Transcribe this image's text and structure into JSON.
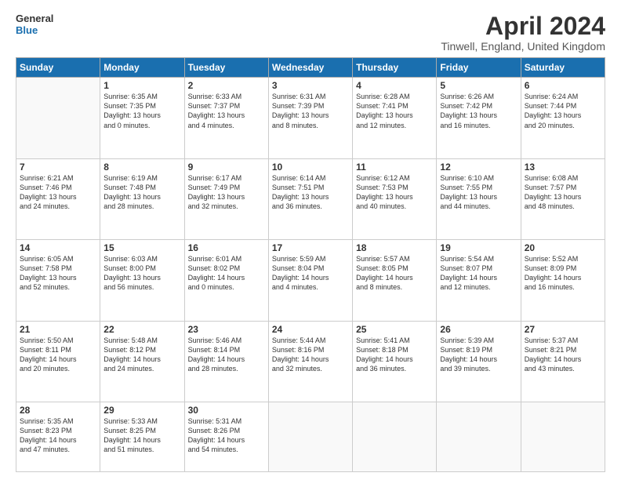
{
  "logo": {
    "line1": "General",
    "line2": "Blue"
  },
  "title": "April 2024",
  "subtitle": "Tinwell, England, United Kingdom",
  "days_of_week": [
    "Sunday",
    "Monday",
    "Tuesday",
    "Wednesday",
    "Thursday",
    "Friday",
    "Saturday"
  ],
  "weeks": [
    [
      {
        "day": "",
        "info": ""
      },
      {
        "day": "1",
        "info": "Sunrise: 6:35 AM\nSunset: 7:35 PM\nDaylight: 13 hours\nand 0 minutes."
      },
      {
        "day": "2",
        "info": "Sunrise: 6:33 AM\nSunset: 7:37 PM\nDaylight: 13 hours\nand 4 minutes."
      },
      {
        "day": "3",
        "info": "Sunrise: 6:31 AM\nSunset: 7:39 PM\nDaylight: 13 hours\nand 8 minutes."
      },
      {
        "day": "4",
        "info": "Sunrise: 6:28 AM\nSunset: 7:41 PM\nDaylight: 13 hours\nand 12 minutes."
      },
      {
        "day": "5",
        "info": "Sunrise: 6:26 AM\nSunset: 7:42 PM\nDaylight: 13 hours\nand 16 minutes."
      },
      {
        "day": "6",
        "info": "Sunrise: 6:24 AM\nSunset: 7:44 PM\nDaylight: 13 hours\nand 20 minutes."
      }
    ],
    [
      {
        "day": "7",
        "info": "Sunrise: 6:21 AM\nSunset: 7:46 PM\nDaylight: 13 hours\nand 24 minutes."
      },
      {
        "day": "8",
        "info": "Sunrise: 6:19 AM\nSunset: 7:48 PM\nDaylight: 13 hours\nand 28 minutes."
      },
      {
        "day": "9",
        "info": "Sunrise: 6:17 AM\nSunset: 7:49 PM\nDaylight: 13 hours\nand 32 minutes."
      },
      {
        "day": "10",
        "info": "Sunrise: 6:14 AM\nSunset: 7:51 PM\nDaylight: 13 hours\nand 36 minutes."
      },
      {
        "day": "11",
        "info": "Sunrise: 6:12 AM\nSunset: 7:53 PM\nDaylight: 13 hours\nand 40 minutes."
      },
      {
        "day": "12",
        "info": "Sunrise: 6:10 AM\nSunset: 7:55 PM\nDaylight: 13 hours\nand 44 minutes."
      },
      {
        "day": "13",
        "info": "Sunrise: 6:08 AM\nSunset: 7:57 PM\nDaylight: 13 hours\nand 48 minutes."
      }
    ],
    [
      {
        "day": "14",
        "info": "Sunrise: 6:05 AM\nSunset: 7:58 PM\nDaylight: 13 hours\nand 52 minutes."
      },
      {
        "day": "15",
        "info": "Sunrise: 6:03 AM\nSunset: 8:00 PM\nDaylight: 13 hours\nand 56 minutes."
      },
      {
        "day": "16",
        "info": "Sunrise: 6:01 AM\nSunset: 8:02 PM\nDaylight: 14 hours\nand 0 minutes."
      },
      {
        "day": "17",
        "info": "Sunrise: 5:59 AM\nSunset: 8:04 PM\nDaylight: 14 hours\nand 4 minutes."
      },
      {
        "day": "18",
        "info": "Sunrise: 5:57 AM\nSunset: 8:05 PM\nDaylight: 14 hours\nand 8 minutes."
      },
      {
        "day": "19",
        "info": "Sunrise: 5:54 AM\nSunset: 8:07 PM\nDaylight: 14 hours\nand 12 minutes."
      },
      {
        "day": "20",
        "info": "Sunrise: 5:52 AM\nSunset: 8:09 PM\nDaylight: 14 hours\nand 16 minutes."
      }
    ],
    [
      {
        "day": "21",
        "info": "Sunrise: 5:50 AM\nSunset: 8:11 PM\nDaylight: 14 hours\nand 20 minutes."
      },
      {
        "day": "22",
        "info": "Sunrise: 5:48 AM\nSunset: 8:12 PM\nDaylight: 14 hours\nand 24 minutes."
      },
      {
        "day": "23",
        "info": "Sunrise: 5:46 AM\nSunset: 8:14 PM\nDaylight: 14 hours\nand 28 minutes."
      },
      {
        "day": "24",
        "info": "Sunrise: 5:44 AM\nSunset: 8:16 PM\nDaylight: 14 hours\nand 32 minutes."
      },
      {
        "day": "25",
        "info": "Sunrise: 5:41 AM\nSunset: 8:18 PM\nDaylight: 14 hours\nand 36 minutes."
      },
      {
        "day": "26",
        "info": "Sunrise: 5:39 AM\nSunset: 8:19 PM\nDaylight: 14 hours\nand 39 minutes."
      },
      {
        "day": "27",
        "info": "Sunrise: 5:37 AM\nSunset: 8:21 PM\nDaylight: 14 hours\nand 43 minutes."
      }
    ],
    [
      {
        "day": "28",
        "info": "Sunrise: 5:35 AM\nSunset: 8:23 PM\nDaylight: 14 hours\nand 47 minutes."
      },
      {
        "day": "29",
        "info": "Sunrise: 5:33 AM\nSunset: 8:25 PM\nDaylight: 14 hours\nand 51 minutes."
      },
      {
        "day": "30",
        "info": "Sunrise: 5:31 AM\nSunset: 8:26 PM\nDaylight: 14 hours\nand 54 minutes."
      },
      {
        "day": "",
        "info": ""
      },
      {
        "day": "",
        "info": ""
      },
      {
        "day": "",
        "info": ""
      },
      {
        "day": "",
        "info": ""
      }
    ]
  ]
}
